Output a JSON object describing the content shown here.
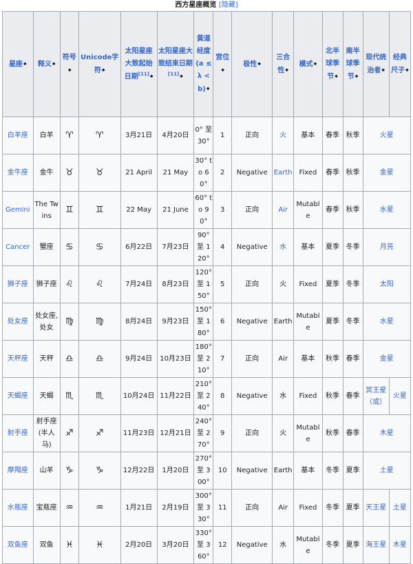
{
  "caption": {
    "title": "西方星座概览",
    "hide_link": "[隐藏]"
  },
  "headers": [
    {
      "label": "星座"
    },
    {
      "label": "释义"
    },
    {
      "label": "符号"
    },
    {
      "label": "Unicode字符"
    },
    {
      "label": "太阳星座大致起始日期",
      "ref": "[11]"
    },
    {
      "label": "太阳星座大致结束日期",
      "ref": "[11]"
    },
    {
      "label": "黄道经度(a ≤ λ < b)"
    },
    {
      "label": "宫位"
    },
    {
      "label": "极性"
    },
    {
      "label": "三合性"
    },
    {
      "label": "模式"
    },
    {
      "label": "北半球季节"
    },
    {
      "label": "南半球季节"
    },
    {
      "label": "现代统治者"
    },
    {
      "label": "经典尺子"
    }
  ],
  "rows": [
    {
      "sign": "白羊座",
      "meaning": "白羊",
      "symbol": "♈",
      "unicode": "♈",
      "start": "3月21日",
      "end": "4月20日",
      "longitude": "0° 至 30°",
      "house": "1",
      "polarity": "正向",
      "element": "火",
      "mode": "基本",
      "north": "春季",
      "south": "秋季",
      "ruler": "火星"
    },
    {
      "sign": "金牛座",
      "meaning": "金牛",
      "symbol": "♉",
      "unicode": "♉",
      "start": "21 April",
      "end": "21 May",
      "longitude": "30° to 60°",
      "house": "2",
      "polarity": "Negative",
      "element": "Earth",
      "mode": "Fixed",
      "north": "春季",
      "south": "秋季",
      "ruler": "金星"
    },
    {
      "sign": "Gemini",
      "meaning": "The Twins",
      "symbol": "♊",
      "unicode": "♊",
      "start": "22 May",
      "end": "21 June",
      "longitude": "60° to 90°",
      "house": "3",
      "polarity": "正向",
      "element": "Air",
      "mode": "Mutable",
      "north": "春季",
      "south": "秋季",
      "ruler": "水星"
    },
    {
      "sign": "Cancer",
      "meaning": "蟹座",
      "symbol": "♋",
      "unicode": "♋",
      "start": "6月22日",
      "end": "7月23日",
      "longitude": "90° 至 120°",
      "house": "4",
      "polarity": "Negative",
      "element": "水",
      "mode": "基本",
      "north": "夏季",
      "south": "冬季",
      "ruler": "月亮"
    },
    {
      "sign": "狮子座",
      "meaning": "狮子座",
      "symbol": "♌",
      "unicode": "♌",
      "start": "7月24日",
      "end": "8月23日",
      "longitude": "120° 至 150°",
      "house": "5",
      "polarity": "正向",
      "element": "火",
      "mode": "Fixed",
      "north": "夏季",
      "south": "冬季",
      "ruler": "太阳"
    },
    {
      "sign": "处女座",
      "meaning": "处女座, 处女",
      "symbol": "♍",
      "unicode": "♍",
      "start": "8月24日",
      "end": "9月23日",
      "longitude": "150° 至 180°",
      "house": "6",
      "polarity": "Negative",
      "element": "Earth",
      "mode": "Mutable",
      "north": "夏季",
      "south": "冬季",
      "ruler": "水星"
    },
    {
      "sign": "天秤座",
      "meaning": "天秤",
      "symbol": "♎",
      "unicode": "♎",
      "start": "9月24日",
      "end": "10月23日",
      "longitude": "180° 至 210°",
      "house": "7",
      "polarity": "正向",
      "element": "Air",
      "mode": "基本",
      "north": "秋季",
      "south": "春季",
      "ruler": "金星"
    },
    {
      "sign": "天蝎座",
      "meaning": "天蝎",
      "symbol": "♏",
      "unicode": "♏",
      "start": "10月24日",
      "end": "11月22日",
      "longitude": "210° 至 240°",
      "house": "8",
      "polarity": "Negative",
      "element": "水",
      "mode": "Fixed",
      "north": "秋季",
      "south": "春季",
      "ruler": "冥王星（或）",
      "classic": "火星"
    },
    {
      "sign": "射手座",
      "meaning": "射手座(半人马)",
      "symbol": "♐",
      "unicode": "♐",
      "start": "11月23日",
      "end": "12月21日",
      "longitude": "240° 至 270°",
      "house": "9",
      "polarity": "正向",
      "element": "火",
      "mode": "Mutable",
      "north": "秋季",
      "south": "春季",
      "ruler": "木星"
    },
    {
      "sign": "摩羯座",
      "meaning": "山羊",
      "symbol": "♑",
      "unicode": "♑",
      "start": "12月22日",
      "end": "1月20日",
      "longitude": "270° 至 300°",
      "house": "10",
      "polarity": "Negative",
      "element": "Earth",
      "mode": "基本",
      "north": "冬季",
      "south": "夏季",
      "ruler": "土星"
    },
    {
      "sign": "水瓶座",
      "meaning": "宝瓶座",
      "symbol": "♒",
      "unicode": "♒",
      "start": "1月21日",
      "end": "2月19日",
      "longitude": "300° 至 330°",
      "house": "11",
      "polarity": "正向",
      "element": "Air",
      "mode": "Fixed",
      "north": "冬季",
      "south": "夏季",
      "ruler": "天王星",
      "classic": "土星"
    },
    {
      "sign": "双鱼座",
      "meaning": "双鱼",
      "symbol": "♓",
      "unicode": "♓",
      "start": "2月20日",
      "end": "3月20日",
      "longitude": "330° 至 360°",
      "house": "12",
      "polarity": "Negative",
      "element": "水",
      "mode": "Mutable",
      "north": "冬季",
      "south": "夏季",
      "ruler": "海王星",
      "classic": "木星"
    }
  ],
  "link_color": "#3366cc",
  "header_bg": "#eaecf0",
  "cell_bg": "#f8f9fa",
  "border_color": "#a2a9b1"
}
